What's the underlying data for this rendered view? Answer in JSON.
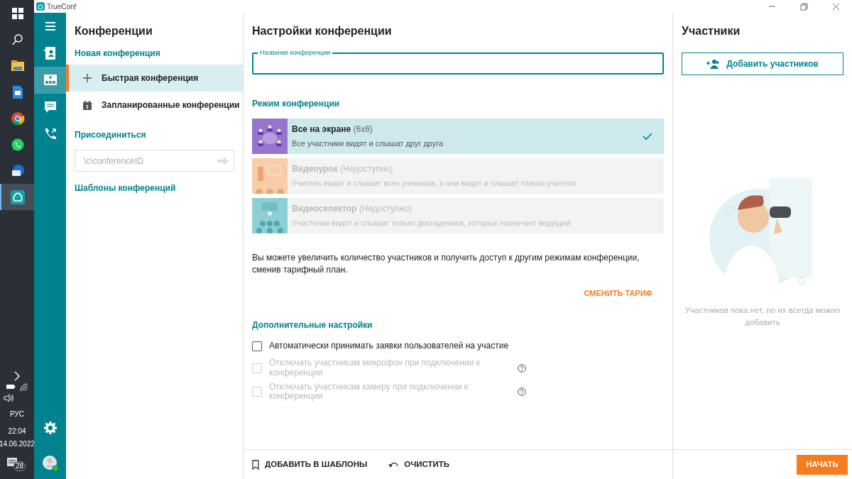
{
  "taskbar": {
    "language": "РУС",
    "time": "22:04",
    "date": "14.06.2022",
    "notification_count": "28",
    "apps": [
      {
        "kind": "folder",
        "selected": false
      },
      {
        "kind": "document",
        "selected": false
      },
      {
        "kind": "browser",
        "selected": false
      },
      {
        "kind": "chat",
        "selected": false
      },
      {
        "kind": "mail",
        "selected": false
      },
      {
        "kind": "trueconf",
        "selected": true
      }
    ]
  },
  "window": {
    "title": "TrueConf"
  },
  "rail": {
    "items": [
      {
        "kind": "contacts",
        "selected": false
      },
      {
        "kind": "conferences",
        "selected": true
      },
      {
        "kind": "chat",
        "selected": false
      },
      {
        "kind": "calls",
        "selected": false
      }
    ],
    "user_online": true
  },
  "conferences": {
    "title": "Конференции",
    "new_title": "Новая конференция",
    "items": [
      {
        "kind": "plus",
        "label": "Быстрая конференция",
        "selected": true
      },
      {
        "kind": "calendar",
        "label": "Запланированные конференции",
        "selected": false
      }
    ],
    "join_title": "Присоединиться",
    "join_placeholder": "\\c\\conferenceID",
    "templates_title": "Шаблоны конференций"
  },
  "settings": {
    "title": "Настройки конференции",
    "name_label": "Название конференции",
    "mode_title": "Режим конференции",
    "modes": [
      {
        "title": "Все на экране",
        "suffix": "(6x6)",
        "description": "Все участники видят и слышат друг друга",
        "color": "#9575cd",
        "selected": true,
        "disabled": false
      },
      {
        "title": "Видеоурок",
        "suffix": "(Недоступно)",
        "description": "Учитель видит и слышит всех учеников, а они видят и слышат только учителя",
        "color": "#f7cda9",
        "selected": false,
        "disabled": true
      },
      {
        "title": "Видеоселектор",
        "suffix": "(Недоступно)",
        "description": "Участники видят и слышат только докладчиков, которых назначает ведущий",
        "color": "#8fcfd3",
        "selected": false,
        "disabled": true
      }
    ],
    "note": "Вы можете увеличить количество участников и получить доступ к другим режимам конференции, сменив тарифный план.",
    "change_plan": "СМЕНИТЬ ТАРИФ",
    "extra_title": "Дополнительные настройки",
    "options": [
      {
        "label": "Автоматически принимать заявки пользователей на участие",
        "checked": false,
        "disabled": false,
        "help": false
      },
      {
        "label": "Отключать участникам микрофон при подключении к конференции",
        "checked": false,
        "disabled": true,
        "help": true
      },
      {
        "label": "Отключать участникам камеру при подключении к конференции",
        "checked": false,
        "disabled": true,
        "help": true
      }
    ]
  },
  "participants": {
    "title": "Участники",
    "add_button": "Добавить участников",
    "empty_text": "Участников пока нет, но их всегда можно добавить"
  },
  "footer": {
    "add_template": "ДОБАВИТЬ В ШАБЛОНЫ",
    "clear": "ОЧИСТИТЬ",
    "start": "НАЧАТЬ"
  }
}
